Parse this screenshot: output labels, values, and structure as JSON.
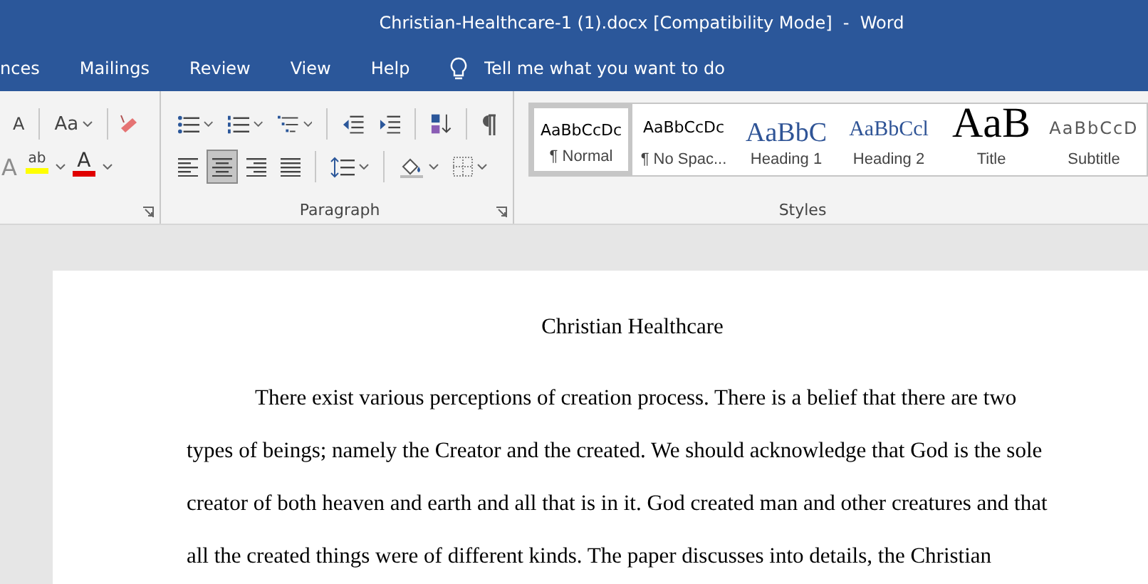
{
  "window": {
    "title": "Christian-Healthcare-1 (1).docx [Compatibility Mode]  -  Word"
  },
  "tabs": [
    {
      "label": "nces",
      "selected": false
    },
    {
      "label": "Mailings",
      "selected": false
    },
    {
      "label": "Review",
      "selected": false
    },
    {
      "label": "View",
      "selected": false
    },
    {
      "label": "Help",
      "selected": false
    }
  ],
  "tell_me": {
    "placeholder": "Tell me what you want to do"
  },
  "font_group": {
    "shrink_font": "A",
    "change_case": "Aa",
    "text_effects": "A",
    "highlight": "ab",
    "font_color": "A"
  },
  "paragraph_group": {
    "label": "Paragraph",
    "alignments": [
      {
        "kind": "left",
        "selected": false
      },
      {
        "kind": "center",
        "selected": true
      },
      {
        "kind": "right",
        "selected": false
      },
      {
        "kind": "justify",
        "selected": false
      }
    ]
  },
  "styles_group": {
    "label": "Styles",
    "styles": [
      {
        "preview": "AaBbCcDc",
        "name": "¶ Normal",
        "kind": "normal",
        "selected": true
      },
      {
        "preview": "AaBbCcDc",
        "name": "¶ No Spac...",
        "kind": "normal",
        "selected": false
      },
      {
        "preview": "AaBbC",
        "name": "Heading 1",
        "kind": "heading1",
        "selected": false
      },
      {
        "preview": "AaBbCcl",
        "name": "Heading 2",
        "kind": "heading2",
        "selected": false
      },
      {
        "preview": "AaB",
        "name": "Title",
        "kind": "title",
        "selected": false
      },
      {
        "preview": "AaBbCcD",
        "name": "Subtitle",
        "kind": "subtitle",
        "selected": false
      }
    ]
  },
  "document": {
    "title": "Christian Healthcare",
    "lines": [
      "There exist various perceptions of creation process. There is a belief that there are two",
      "types of beings; namely the Creator and the created. We should acknowledge that God is the sole",
      "creator of both heaven and earth and all that is in it. God created man and other creatures and that",
      "all the created things were of different kinds. The paper discusses into details, the Christian"
    ]
  }
}
